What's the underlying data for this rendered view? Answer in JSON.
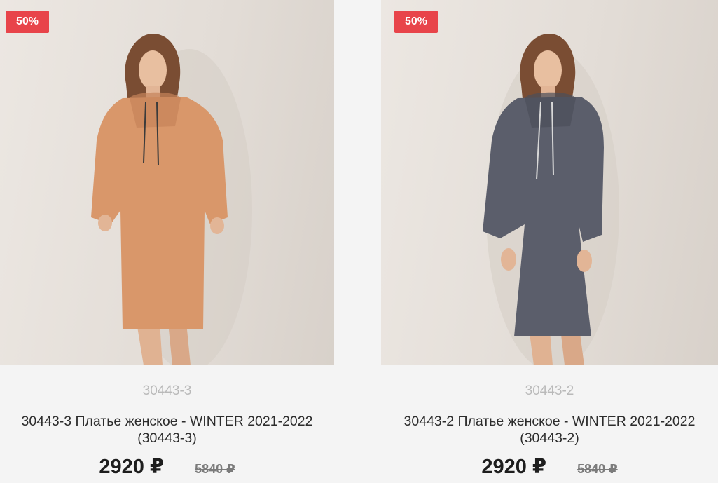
{
  "products": [
    {
      "badge": "50%",
      "sku": "30443-3",
      "title_line1": "30443-3 Платье женское - WINTER 2021-2022",
      "title_line2": "(30443-3)",
      "price": "2920 ₽",
      "old_price": "5840 ₽",
      "dress_color": "#d9976a"
    },
    {
      "badge": "50%",
      "sku": "30443-2",
      "title_line1": "30443-2 Платье женское - WINTER 2021-2022",
      "title_line2": "(30443-2)",
      "price": "2920 ₽",
      "old_price": "5840 ₽",
      "dress_color": "#5b5e6b"
    }
  ],
  "colors": {
    "badge_bg": "#e8444a",
    "page_bg": "#f4f4f4"
  }
}
